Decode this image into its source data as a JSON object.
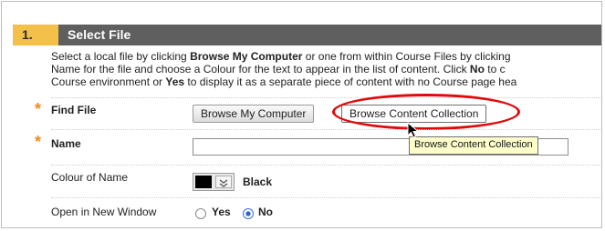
{
  "step": {
    "number": "1.",
    "title": "Select File"
  },
  "instructions": {
    "line1_pre": "Select a local file by clicking ",
    "line1_bold1": "Browse My Computer",
    "line1_post": " or one from within Course Files by clicking",
    "line2_pre": "Name for the file and choose a Colour for the text to appear in the list of content. Click ",
    "line2_bold": "No",
    "line2_post": " to c",
    "line3_pre": "Course environment or ",
    "line3_bold": "Yes",
    "line3_post": " to display it as a separate piece of content with no Course page hea"
  },
  "fields": {
    "find_file": {
      "label": "Find File",
      "browse_computer": "Browse My Computer",
      "browse_collection": "Browse Content Collection"
    },
    "name": {
      "label": "Name",
      "value": ""
    },
    "colour": {
      "label": "Colour of Name",
      "value": "Black",
      "swatch_color": "#000000"
    },
    "new_window": {
      "label": "Open in New Window",
      "yes": "Yes",
      "no": "No",
      "selected": "No"
    }
  },
  "tooltip": "Browse Content Collection",
  "colors": {
    "header_bg": "#5f5f5f",
    "step_number_bg": "#f3c04a",
    "required_star": "#f08a1c",
    "highlight": "#e10a0a",
    "tooltip_bg": "#ffffcc"
  },
  "icons": {
    "required": "asterisk-icon",
    "cursor": "mouse-pointer-icon",
    "dropdown": "chevron-down-icon"
  }
}
